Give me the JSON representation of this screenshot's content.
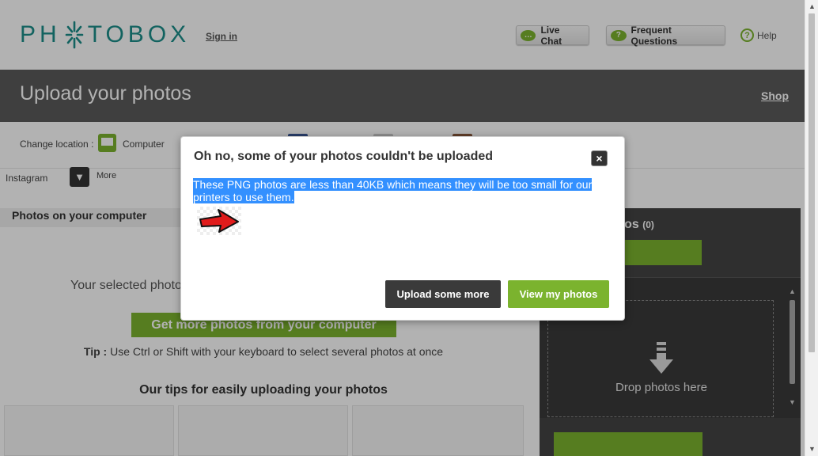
{
  "header": {
    "logo_text_left": "PH",
    "logo_text_right": "TOBOX",
    "sign_in": "Sign in",
    "live_chat": "Live Chat",
    "faq": "Frequent Questions",
    "help": "Help"
  },
  "band": {
    "title": "Upload your photos",
    "shop": "Shop"
  },
  "location": {
    "label": "Change location :",
    "computer": "Computer",
    "instagram": "Instagram",
    "more": "More"
  },
  "left_panel": {
    "heading": "Photos on your computer",
    "selected_msg": "Your selected photo",
    "get_more_button": "Get more photos from your computer",
    "tip_label": "Tip :",
    "tip_text": " Use Ctrl or Shift with your keyboard to select several photos at once",
    "tips_title": "Our tips for easily uploading your photos"
  },
  "right_panel": {
    "title": "otos",
    "count": "(0)",
    "drop_text": "Drop photos here"
  },
  "modal": {
    "title": "Oh no, some of your photos couldn't be uploaded",
    "close": "×",
    "message": "These PNG photos are less than 40KB which means they will be too small for our printers to use them.",
    "upload_more_button": "Upload some more",
    "view_photos_button": "View my photos"
  },
  "colors": {
    "brand_teal": "#1c8e8a",
    "accent_green": "#7bb32e",
    "band_gray": "#5b5b5b",
    "selection_blue": "#3390ff"
  }
}
